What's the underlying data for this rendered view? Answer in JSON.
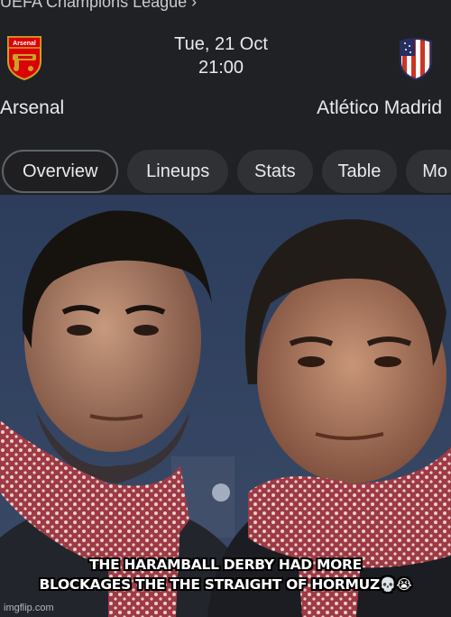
{
  "match": {
    "competition": "UEFA Champions League ›",
    "date": "Tue, 21 Oct",
    "time": "21:00",
    "home_team": "Arsenal",
    "away_team": "Atlético Madrid",
    "home_crest_text": "Arsenal",
    "home_crest_icon": "arsenal-crest-icon",
    "away_crest_icon": "atletico-crest-icon"
  },
  "tabs": [
    {
      "label": "Overview",
      "active": true
    },
    {
      "label": "Lineups",
      "active": false
    },
    {
      "label": "Stats",
      "active": false
    },
    {
      "label": "Table",
      "active": false
    },
    {
      "label": "Mo",
      "active": false
    }
  ],
  "meme": {
    "caption_line1": "THE HARAMBALL DERBY HAD MORE",
    "caption_line2": "BLOCKAGES THE THE STRAIGHT OF HORMUZ",
    "caption_emojis": "💀😭",
    "watermark": "imgflip.com"
  },
  "colors": {
    "card_bg": "#202124",
    "tab_bg": "#303134",
    "text": "#e8eaed",
    "arsenal_red": "#db0007",
    "atletico_red": "#cb3524",
    "atletico_blue": "#272e61"
  }
}
